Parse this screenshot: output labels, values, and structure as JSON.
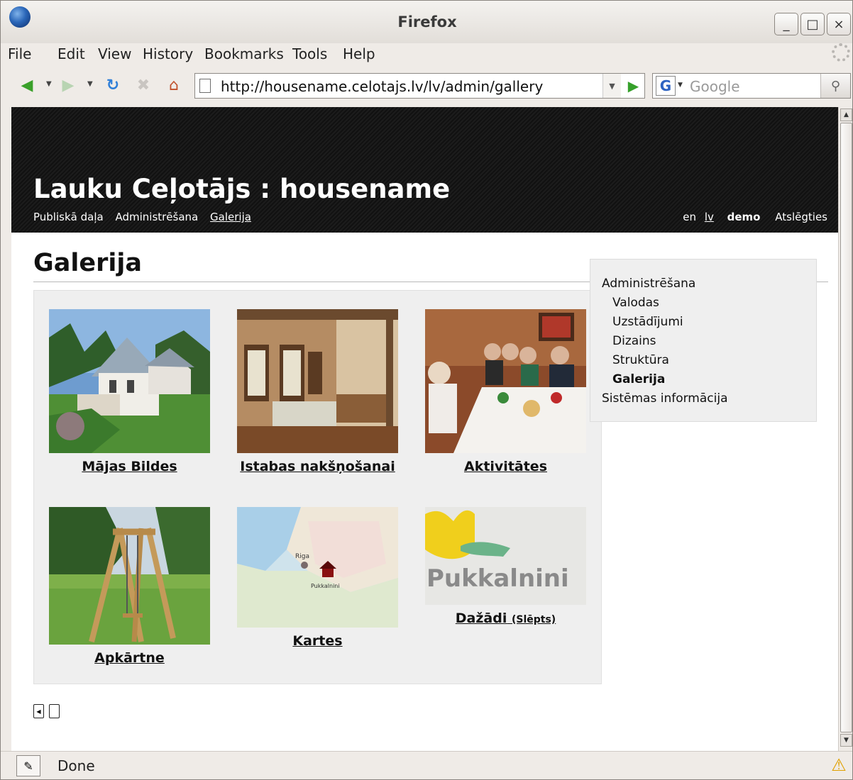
{
  "window": {
    "title": "Firefox",
    "controls": [
      "_",
      "□",
      "×"
    ]
  },
  "menu": [
    "File",
    "Edit",
    "View",
    "History",
    "Bookmarks",
    "Tools",
    "Help"
  ],
  "address": {
    "url": "http://housename.celotajs.lv/lv/admin/gallery"
  },
  "search": {
    "placeholder": "Google",
    "engine_letter": "G"
  },
  "site": {
    "title": "Lauku Ceļotājs : housename",
    "nav": [
      "Publiskā daļa",
      "Administrēšana",
      "Galerija"
    ],
    "lang_en": "en",
    "lang_lv": "lv",
    "user": "demo",
    "logout": "Atslēgties"
  },
  "page": {
    "heading": "Galerija"
  },
  "gallery": [
    {
      "label": "Mājas Bildes",
      "icon": "house-photo"
    },
    {
      "label": "Istabas nakšņošanai",
      "icon": "bedroom-photo"
    },
    {
      "label": "Aktivitātes",
      "icon": "dinner-photo"
    },
    {
      "label": "Apkārtne",
      "icon": "swing-photo"
    },
    {
      "label": "Kartes",
      "icon": "map-photo",
      "map_labels": [
        "Riga",
        "Pukkalnini"
      ]
    },
    {
      "label": "Dažādi",
      "note": "(Slēpts)",
      "icon": "logo-photo",
      "logo_text": "Pukkalnini"
    }
  ],
  "admin_menu": [
    {
      "label": "Administrēšana",
      "level": 0
    },
    {
      "label": "Valodas",
      "level": 1
    },
    {
      "label": "Uzstādījumi",
      "level": 1
    },
    {
      "label": "Dizains",
      "level": 1
    },
    {
      "label": "Struktūra",
      "level": 1
    },
    {
      "label": "Galerija",
      "level": 1,
      "active": true
    },
    {
      "label": "Sistēmas informācija",
      "level": 0
    }
  ],
  "status": {
    "text": "Done"
  },
  "colors": {
    "header_bg": "#111111",
    "gallery_bg": "#efefef",
    "chrome": "#efebe7"
  }
}
